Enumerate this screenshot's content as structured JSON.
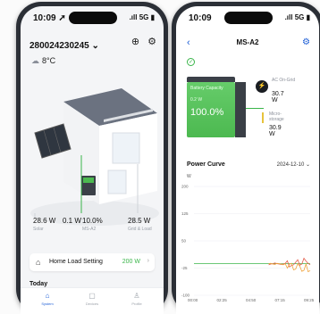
{
  "left_phone": {
    "status": {
      "time": "10:09 ➚",
      "signal": ".ıll 5G ▮"
    },
    "header": {
      "serial": "280024230245 ⌄",
      "add_icon": "⊕",
      "settings_icon": "⚙"
    },
    "weather": {
      "icon": "cloud-icon",
      "temp": "8°C"
    },
    "metrics": [
      {
        "value": "28.6 W",
        "label": "Solar"
      },
      {
        "value": "0.1 W",
        "label": ""
      },
      {
        "value": "10.0%",
        "label": "MS-A2"
      },
      {
        "value": "28.5 W",
        "label": "Grid & Load"
      }
    ],
    "home_load": {
      "label": "Home Load Setting",
      "value": "200 W",
      "chevron": "›"
    },
    "today": "Today",
    "tabs": [
      {
        "label": "System",
        "icon": "⌂"
      },
      {
        "label": "Devices",
        "icon": "▢"
      },
      {
        "label": "Profile",
        "icon": "♙"
      }
    ]
  },
  "right_phone": {
    "status": {
      "time": "10:09",
      "signal": ".ıll 5G ▮"
    },
    "header": {
      "back": "‹",
      "title": "MS-A2",
      "settings": "⚙"
    },
    "battery": {
      "label": "Battery Capacity",
      "power": "0.2 W",
      "percent": "100.0%"
    },
    "grid": {
      "name": "AC On-Grid",
      "value": "30.7 W"
    },
    "microbattery": {
      "name": "Micro-storage",
      "value": "30.9 W"
    },
    "power_curve": {
      "title": "Power Curve",
      "date": "2024-12-10 ⌄",
      "unit": "W"
    }
  },
  "chart_data": {
    "type": "line",
    "title": "Power Curve",
    "ylabel": "W",
    "ylim": [
      -100,
      200
    ],
    "yticks": [
      200,
      125,
      50,
      -25,
      -100
    ],
    "x": [
      "00:00",
      "00:10",
      "00:20",
      "00:30",
      "00:40",
      "00:50",
      "01:00",
      "01:10",
      "01:20",
      "01:30",
      "01:40",
      "01:50",
      "02:00",
      "02:10",
      "02:20",
      "02:30",
      "02:40",
      "02:50",
      "03:00",
      "03:10",
      "03:20",
      "03:30",
      "03:40",
      "03:50",
      "04:00",
      "04:10",
      "04:20",
      "04:30",
      "04:40",
      "04:50",
      "05:00",
      "05:10",
      "05:20",
      "05:30",
      "05:40",
      "05:50",
      "06:00",
      "06:10",
      "06:20",
      "06:30",
      "06:40",
      "06:50",
      "07:00",
      "07:10",
      "07:20",
      "07:30",
      "07:40",
      "07:50",
      "08:00",
      "08:10",
      "08:20",
      "08:30",
      "08:40",
      "08:50",
      "09:00",
      "09:10",
      "09:20"
    ],
    "xticks": [
      "00:00",
      "02:25",
      "04:50",
      "07:15",
      "09:25"
    ],
    "series": [
      {
        "color": "#3ab54a",
        "values": [
          -13,
          -13,
          -13,
          -13,
          -13,
          -13,
          -13,
          -13,
          -13,
          -13,
          -13,
          -13,
          -13,
          -13,
          -13,
          -13,
          -13,
          -13,
          -13,
          -13,
          -13,
          -13,
          -13,
          -13,
          -13,
          -13,
          -13,
          -13,
          -13,
          -13,
          -13,
          -13,
          -13,
          -13,
          -13,
          -13,
          -13,
          -13,
          -13,
          -13,
          -13,
          -13,
          -13,
          -13,
          -13,
          -13,
          -13,
          -13,
          -13,
          -13,
          -13,
          -13,
          -13,
          -13,
          -13,
          -13,
          -13
        ]
      },
      {
        "color": "#e35b4a",
        "values": [
          null,
          null,
          null,
          null,
          null,
          null,
          null,
          null,
          null,
          null,
          null,
          null,
          null,
          null,
          null,
          null,
          null,
          null,
          null,
          null,
          null,
          null,
          null,
          null,
          null,
          null,
          null,
          null,
          null,
          null,
          null,
          null,
          null,
          null,
          null,
          null,
          -16,
          -14,
          -13,
          -11,
          -13,
          -14,
          -15,
          -14,
          -12,
          -5,
          -22,
          -18,
          -16,
          -9,
          -2,
          -17,
          -14,
          2,
          -6,
          -12,
          -16
        ]
      },
      {
        "color": "#f0a23a",
        "values": [
          null,
          null,
          null,
          null,
          null,
          null,
          null,
          null,
          null,
          null,
          null,
          null,
          null,
          null,
          null,
          null,
          null,
          null,
          null,
          null,
          null,
          null,
          null,
          null,
          null,
          null,
          null,
          null,
          null,
          null,
          null,
          null,
          null,
          null,
          null,
          null,
          -13,
          -12,
          -14,
          -15,
          -12,
          -13,
          -14,
          -16,
          -13,
          -25,
          -15,
          -12,
          -30,
          -28,
          -13,
          -20,
          -34,
          -31,
          -14,
          -35,
          -32
        ]
      }
    ],
    "grid": true,
    "legend": "none"
  }
}
